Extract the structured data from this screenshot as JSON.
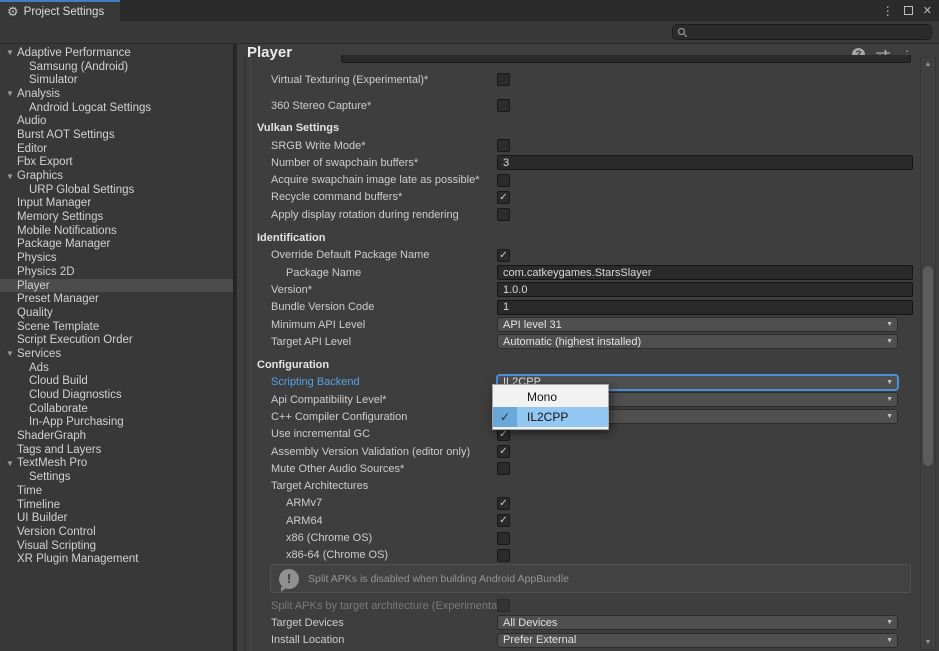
{
  "window": {
    "tab_title": "Project Settings",
    "controls": {
      "menu": "kebab-menu",
      "maximize": "maximize",
      "close": "close"
    }
  },
  "search": {
    "value": "",
    "placeholder": ""
  },
  "icons": {
    "gear_glyph": "⚙",
    "kebab_glyph": "⋮",
    "close_glyph": "✕",
    "help_glyph": "?",
    "foldout_glyph": "▼",
    "check_glyph": "✓",
    "dropdown_arrow_glyph": "▼",
    "scroll_up_glyph": "▲",
    "scroll_down_glyph": "▼",
    "warning_glyph": "!"
  },
  "colors": {
    "tab_indicator_blue": "#4180c0",
    "focus_border_blue": "#4a90d9",
    "highlight_label_blue": "#56a1e9",
    "popup_selection_blue": "#92c7f2",
    "sidebar_selection_gray": "#4c4c4c"
  },
  "sidebar": {
    "items": [
      {
        "label": "Adaptive Performance",
        "indent": 0,
        "expand": true
      },
      {
        "label": "Samsung (Android)",
        "indent": 1
      },
      {
        "label": "Simulator",
        "indent": 1
      },
      {
        "label": "Analysis",
        "indent": 0,
        "expand": true
      },
      {
        "label": "Android Logcat Settings",
        "indent": 1
      },
      {
        "label": "Audio",
        "indent": 0
      },
      {
        "label": "Burst AOT Settings",
        "indent": 0
      },
      {
        "label": "Editor",
        "indent": 0
      },
      {
        "label": "Fbx Export",
        "indent": 0
      },
      {
        "label": "Graphics",
        "indent": 0,
        "expand": true
      },
      {
        "label": "URP Global Settings",
        "indent": 1
      },
      {
        "label": "Input Manager",
        "indent": 0
      },
      {
        "label": "Memory Settings",
        "indent": 0
      },
      {
        "label": "Mobile Notifications",
        "indent": 0
      },
      {
        "label": "Package Manager",
        "indent": 0
      },
      {
        "label": "Physics",
        "indent": 0
      },
      {
        "label": "Physics 2D",
        "indent": 0
      },
      {
        "label": "Player",
        "indent": 0,
        "selected": true
      },
      {
        "label": "Preset Manager",
        "indent": 0
      },
      {
        "label": "Quality",
        "indent": 0
      },
      {
        "label": "Scene Template",
        "indent": 0
      },
      {
        "label": "Script Execution Order",
        "indent": 0
      },
      {
        "label": "Services",
        "indent": 0,
        "expand": true
      },
      {
        "label": "Ads",
        "indent": 1
      },
      {
        "label": "Cloud Build",
        "indent": 1
      },
      {
        "label": "Cloud Diagnostics",
        "indent": 1
      },
      {
        "label": "Collaborate",
        "indent": 1
      },
      {
        "label": "In-App Purchasing",
        "indent": 1
      },
      {
        "label": "ShaderGraph",
        "indent": 0
      },
      {
        "label": "Tags and Layers",
        "indent": 0
      },
      {
        "label": "TextMesh Pro",
        "indent": 0,
        "expand": true
      },
      {
        "label": "Settings",
        "indent": 1
      },
      {
        "label": "Time",
        "indent": 0
      },
      {
        "label": "Timeline",
        "indent": 0
      },
      {
        "label": "UI Builder",
        "indent": 0
      },
      {
        "label": "Version Control",
        "indent": 0
      },
      {
        "label": "Visual Scripting",
        "indent": 0
      },
      {
        "label": "XR Plugin Management",
        "indent": 0
      }
    ]
  },
  "main": {
    "title": "Player",
    "rows": [
      {
        "type": "partial-top"
      },
      {
        "type": "checkbox",
        "label": "Virtual Texturing (Experimental)*",
        "checked": false,
        "mt": 8
      },
      {
        "type": "checkbox",
        "label": "360 Stereo Capture*",
        "checked": false,
        "mt": 9
      },
      {
        "type": "header",
        "label": "Vulkan Settings",
        "mt": 5
      },
      {
        "type": "checkbox",
        "label": "SRGB Write Mode*",
        "checked": false
      },
      {
        "type": "textfield",
        "label": "Number of swapchain buffers*",
        "value": "3"
      },
      {
        "type": "checkbox",
        "label": "Acquire swapchain image late as possible*",
        "checked": false
      },
      {
        "type": "checkbox",
        "label": "Recycle command buffers*",
        "checked": true
      },
      {
        "type": "checkbox",
        "label": "Apply display rotation during rendering",
        "checked": false
      },
      {
        "type": "header",
        "label": "Identification",
        "mt": 6
      },
      {
        "type": "checkbox",
        "label": "Override Default Package Name",
        "checked": true
      },
      {
        "type": "textfield",
        "label": "Package Name",
        "value": "com.catkeygames.StarsSlayer",
        "indent": 1
      },
      {
        "type": "textfield",
        "label": "Version*",
        "value": "1.0.0"
      },
      {
        "type": "textfield",
        "label": "Bundle Version Code",
        "value": "1"
      },
      {
        "type": "dropdown",
        "label": "Minimum API Level",
        "value": "API level 31"
      },
      {
        "type": "dropdown",
        "label": "Target API Level",
        "value": "Automatic (highest installed)"
      },
      {
        "type": "header",
        "label": "Configuration",
        "mt": 6
      },
      {
        "type": "dropdown",
        "label": "Scripting Backend",
        "value": "IL2CPP",
        "focused": true,
        "blue": true
      },
      {
        "type": "dropdown",
        "label": "Api Compatibility Level*",
        "value": ""
      },
      {
        "type": "dropdown",
        "label": "C++ Compiler Configuration",
        "value": ""
      },
      {
        "type": "checkbox",
        "label": "Use incremental GC",
        "checked": true
      },
      {
        "type": "checkbox",
        "label": "Assembly Version Validation (editor only)",
        "checked": true
      },
      {
        "type": "checkbox",
        "label": "Mute Other Audio Sources*",
        "checked": false
      },
      {
        "type": "label",
        "label": "Target Architectures"
      },
      {
        "type": "checkbox",
        "label": "ARMv7",
        "checked": true,
        "indent": 1
      },
      {
        "type": "checkbox",
        "label": "ARM64",
        "checked": true,
        "indent": 1
      },
      {
        "type": "checkbox",
        "label": "x86 (Chrome OS)",
        "checked": false,
        "indent": 1
      },
      {
        "type": "checkbox",
        "label": "x86-64 (Chrome OS)",
        "checked": false,
        "indent": 1
      },
      {
        "type": "infobox",
        "text": "Split APKs is disabled when building Android AppBundle"
      },
      {
        "type": "checkbox",
        "label": "Split APKs by target architecture (Experimenta",
        "checked": false,
        "disabled": true,
        "mt": 4
      },
      {
        "type": "dropdown",
        "label": "Target Devices",
        "value": "All Devices"
      },
      {
        "type": "dropdown",
        "label": "Install Location",
        "value": "Prefer External"
      },
      {
        "type": "partial-bottom"
      }
    ],
    "popup": {
      "anchor": "Scripting Backend",
      "options": [
        {
          "label": "Mono",
          "selected": false
        },
        {
          "label": "IL2CPP",
          "selected": true
        }
      ]
    }
  }
}
